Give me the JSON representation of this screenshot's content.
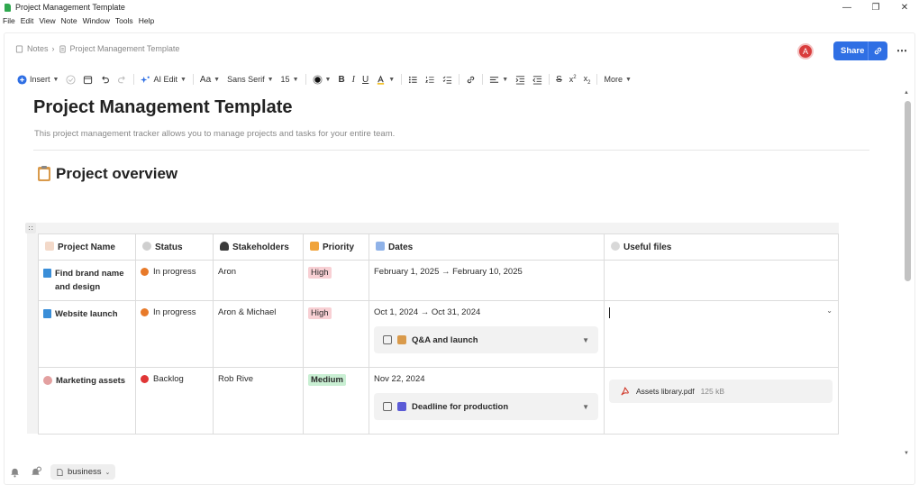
{
  "window": {
    "title": "Project Management Template"
  },
  "menu": [
    "File",
    "Edit",
    "View",
    "Note",
    "Window",
    "Tools",
    "Help"
  ],
  "breadcrumb": {
    "root": "Notes",
    "separator": "›",
    "current": "Project Management Template"
  },
  "header": {
    "avatar_initial": "A",
    "share_label": "Share"
  },
  "toolbar": {
    "insert": "Insert",
    "ai_edit": "AI Edit",
    "font_size_icon": "Aa",
    "font_family": "Sans Serif",
    "font_size": "15",
    "more": "More"
  },
  "doc": {
    "title": "Project Management Template",
    "subtitle": "This project management tracker allows you to manage projects and tasks for your entire team.",
    "section_title": "Project overview"
  },
  "table": {
    "headers": [
      "Project Name",
      "Status",
      "Stakeholders",
      "Priority",
      "Dates",
      "Useful files"
    ],
    "rows": [
      {
        "name": "Find brand name and design",
        "status": "In progress",
        "stakeholders": "Aron",
        "priority": "High",
        "dates": "February 1, 2025 → February 10, 2025"
      },
      {
        "name": "Website launch",
        "status": "In progress",
        "stakeholders": "Aron & Michael",
        "priority": "High",
        "dates": "Oct 1, 2024 → Oct 31, 2024",
        "sub": "Q&A and launch"
      },
      {
        "name": "Marketing assets",
        "status": "Backlog",
        "stakeholders": "Rob Rive",
        "priority": "Medium",
        "dates": "Nov 22, 2024",
        "sub": "Deadline for production",
        "file_name": "Assets library.pdf",
        "file_size": "125 kB"
      }
    ]
  },
  "colors": {
    "in_progress": "#e87a2a",
    "backlog": "#e03636",
    "high_bg": "#f8d0d4",
    "medium_bg": "#c9efd3",
    "accent": "#2f6fe4"
  },
  "footer": {
    "workspace": "business"
  }
}
